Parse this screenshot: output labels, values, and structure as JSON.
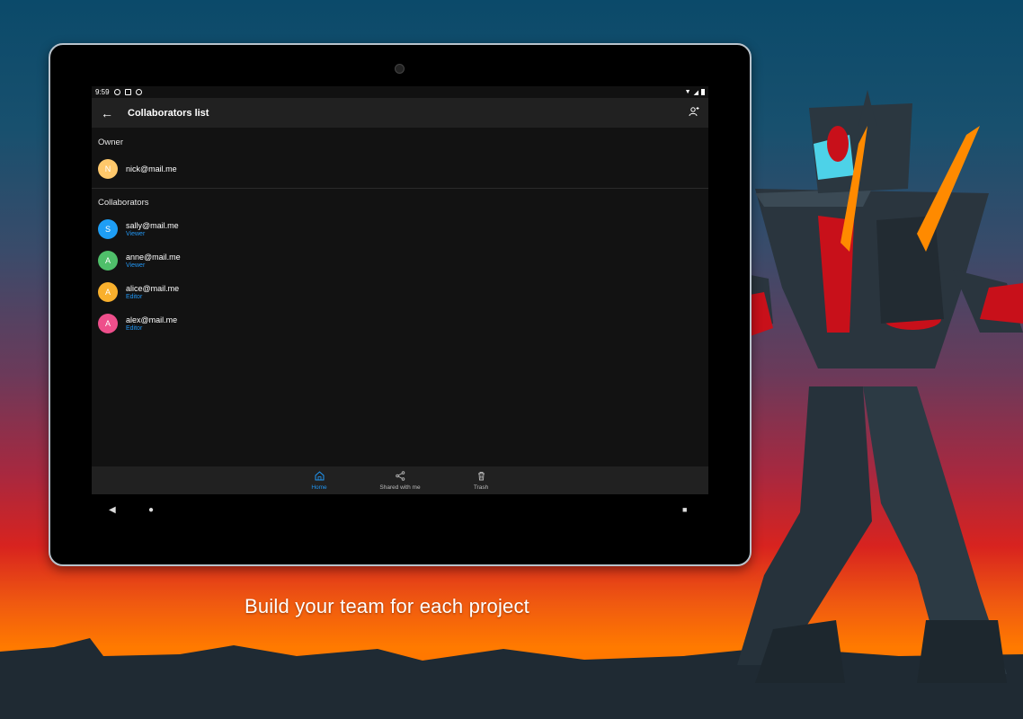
{
  "caption": "Build your team for each project",
  "status": {
    "time": "9:59"
  },
  "appbar": {
    "title": "Collaborators list",
    "back_icon": "arrow-back-icon",
    "add_icon": "person-add-icon"
  },
  "owner_section": {
    "label": "Owner",
    "items": [
      {
        "initial": "N",
        "email": "nick@mail.me",
        "color": "#ffc86b"
      }
    ]
  },
  "collab_section": {
    "label": "Collaborators",
    "items": [
      {
        "initial": "S",
        "email": "sally@mail.me",
        "role": "Viewer",
        "color": "#1e9ef5"
      },
      {
        "initial": "A",
        "email": "anne@mail.me",
        "role": "Viewer",
        "color": "#4fbf6a"
      },
      {
        "initial": "A",
        "email": "alice@mail.me",
        "role": "Editor",
        "color": "#f9b02d"
      },
      {
        "initial": "A",
        "email": "alex@mail.me",
        "role": "Editor",
        "color": "#ee4f8b"
      }
    ]
  },
  "bottomnav": [
    {
      "label": "Home",
      "icon": "home-icon",
      "active": true
    },
    {
      "label": "Shared with me",
      "icon": "share-icon",
      "active": false
    },
    {
      "label": "Trash",
      "icon": "trash-icon",
      "active": false
    }
  ],
  "colors": {
    "accent": "#2196f3",
    "screen_bg": "#121212",
    "bar_bg": "#212121"
  }
}
